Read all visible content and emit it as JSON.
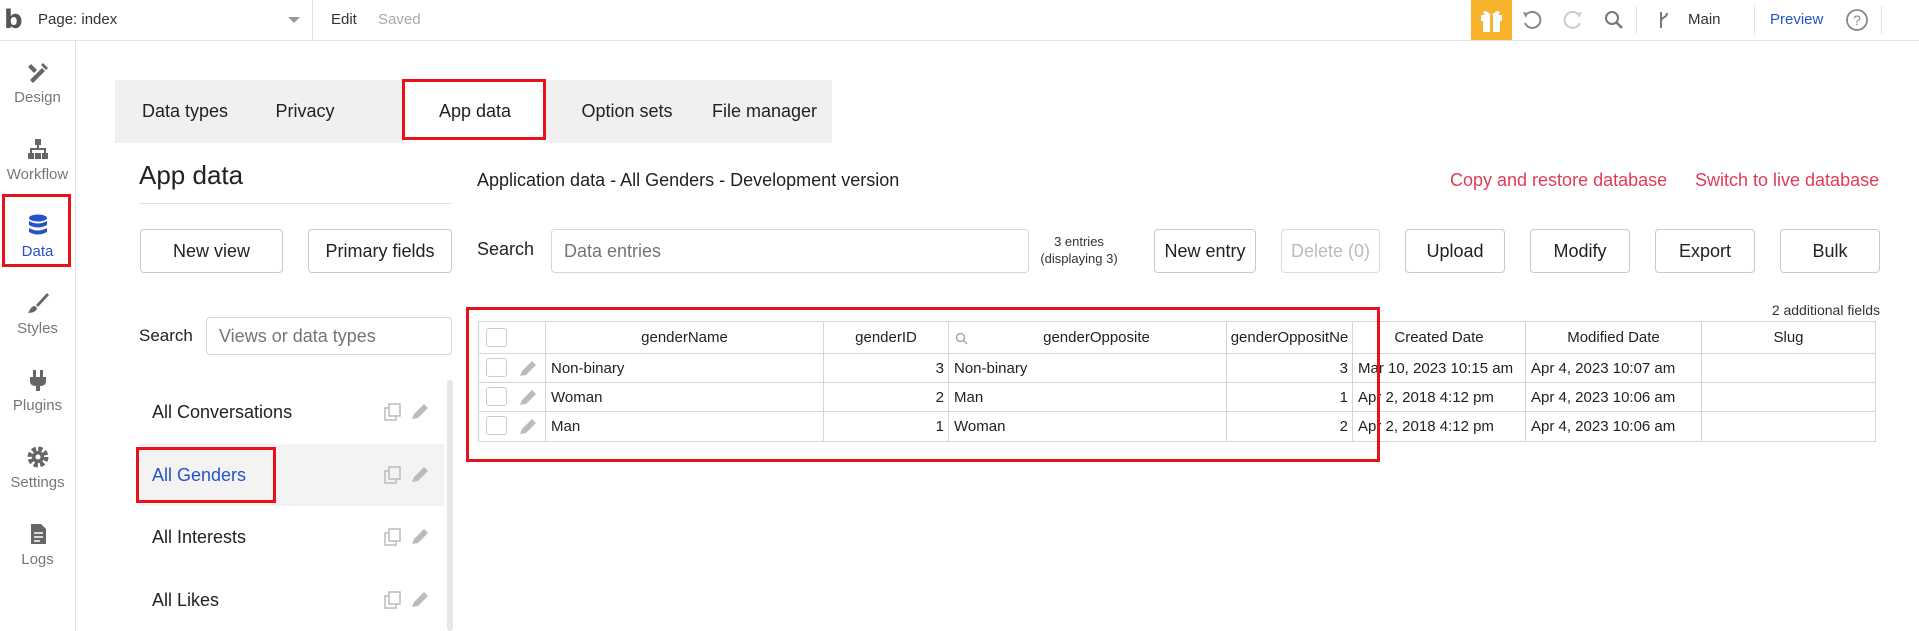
{
  "topbar": {
    "logo": "b",
    "page_label": "Page: index",
    "edit": "Edit",
    "saved": "Saved",
    "branch": "Main",
    "preview": "Preview"
  },
  "nav": {
    "design": "Design",
    "workflow": "Workflow",
    "data": "Data",
    "styles": "Styles",
    "plugins": "Plugins",
    "settings": "Settings",
    "logs": "Logs"
  },
  "tabs": [
    "Data types",
    "Privacy",
    "App data",
    "Option sets",
    "File manager"
  ],
  "left": {
    "heading": "App data",
    "new_view": "New view",
    "primary_fields": "Primary fields",
    "search_label": "Search",
    "search_placeholder": "Views or data types",
    "items": [
      "All Conversations",
      "All Genders",
      "All Interests",
      "All Likes"
    ]
  },
  "main": {
    "title": "Application data - All Genders - Development version",
    "copy_restore": "Copy and restore database",
    "switch_live": "Switch to live database",
    "search_label": "Search",
    "search_placeholder": "Data entries",
    "entries_line1": "3 entries",
    "entries_line2": "(displaying 3)",
    "buttons": {
      "new_entry": "New entry",
      "delete": "Delete (0)",
      "upload": "Upload",
      "modify": "Modify",
      "export": "Export",
      "bulk": "Bulk"
    },
    "additional_fields": "2 additional fields"
  },
  "table": {
    "columns": [
      "genderName",
      "genderID",
      "genderOpposite",
      "genderOppositNe",
      "Created Date",
      "Modified Date",
      "Slug"
    ],
    "rows": [
      [
        "Non-binary",
        "3",
        "Non-binary",
        "3",
        "Mar 10, 2023 10:15 am",
        "Apr 4, 2023 10:07 am",
        ""
      ],
      [
        "Woman",
        "2",
        "Man",
        "1",
        "Apr 2, 2018 4:12 pm",
        "Apr 4, 2023 10:06 am",
        ""
      ],
      [
        "Man",
        "1",
        "Woman",
        "2",
        "Apr 2, 2018 4:12 pm",
        "Apr 4, 2023 10:06 am",
        ""
      ]
    ]
  },
  "colors": {
    "accent_blue": "#2454c8",
    "highlight_red": "#e8101a",
    "link_red": "#e23b57",
    "gift_yellow": "#f7b32b"
  },
  "icons": [
    "bubble-logo-icon",
    "chevron-down-icon",
    "gift-icon",
    "undo-icon",
    "redo-icon",
    "search-icon",
    "branch-icon",
    "help-icon",
    "design-icon",
    "workflow-icon",
    "database-icon",
    "brush-icon",
    "plug-icon",
    "gear-icon",
    "document-icon",
    "copy-icon",
    "pencil-icon"
  ]
}
